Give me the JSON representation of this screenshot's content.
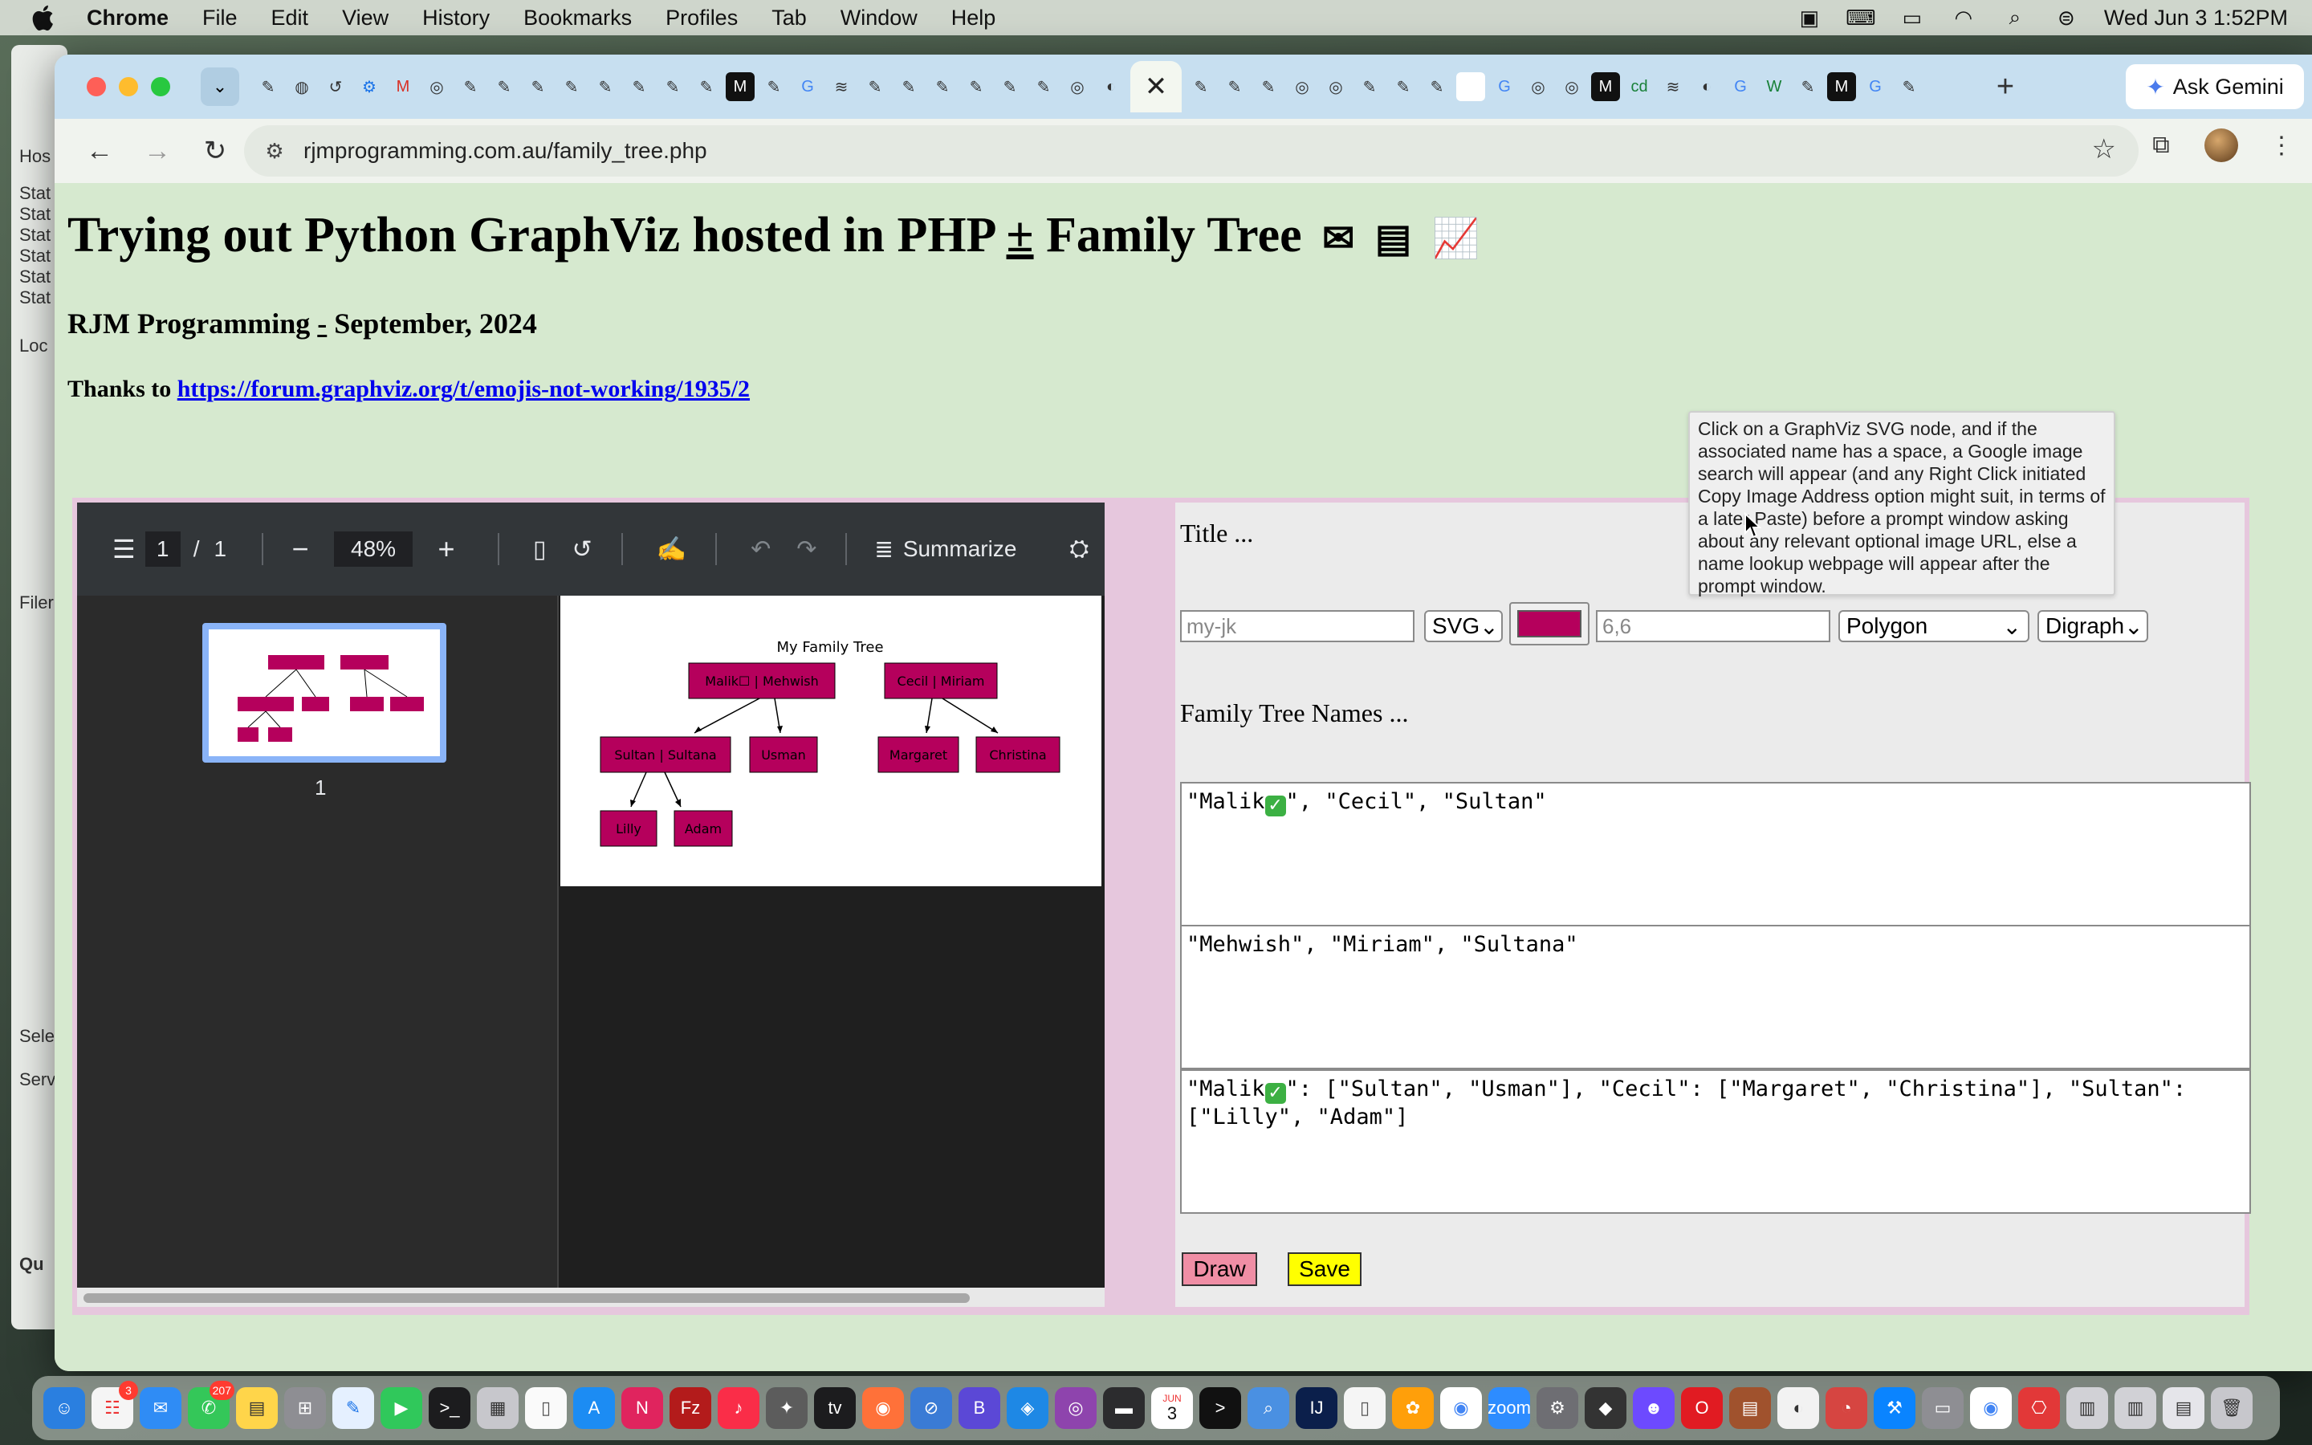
{
  "menubar": {
    "app": "Chrome",
    "items": [
      "File",
      "Edit",
      "View",
      "History",
      "Bookmarks",
      "Profiles",
      "Tab",
      "Window",
      "Help"
    ],
    "clock": "Wed Jun 3  1:52PM"
  },
  "behind_window": {
    "labels": [
      "Hos",
      "Stat",
      "Stat",
      "Stat",
      "Stat",
      "Stat",
      "Stat",
      "Loc",
      "Filer",
      "Sele",
      "Serv",
      "Qu"
    ]
  },
  "browser": {
    "ask_gemini": "Ask Gemini",
    "url": "rjmprogramming.com.au/family_tree.php"
  },
  "page": {
    "title_part1": "Trying out Python GraphViz hosted in PHP ",
    "title_pm": "±",
    "title_part2": " Family Tree",
    "subtitle_part1": "RJM Programming ",
    "subtitle_dash": "-",
    "subtitle_part2": " September, 2024",
    "thanks_label": "Thanks to ",
    "thanks_link": "https://forum.graphviz.org/t/emojis-not-working/1935/2"
  },
  "pdf_viewer": {
    "page_current": "1",
    "page_sep": "/",
    "page_total": "1",
    "zoom": "48%",
    "summarize": "Summarize",
    "thumb_label": "1"
  },
  "graph": {
    "title": "My Family Tree",
    "nodes": [
      "Malik☐ | Mehwish",
      "Cecil | Miriam",
      "Sultan | Sultana",
      "Usman",
      "Margaret",
      "Christina",
      "Lilly",
      "Adam"
    ],
    "node_color": "#b5005c"
  },
  "form": {
    "title_label": "Title ...",
    "name_placeholder": "my-jk",
    "format": "SVG",
    "color": "#b5005c",
    "size_placeholder": "6,6",
    "shape": "Polygon",
    "graph_type": "Digraph",
    "names_label": "Family Tree Names ...",
    "ta1_a": "\"Malik",
    "ta1_b": "\", \"Cecil\", \"Sultan\"",
    "ta2": "\"Mehwish\", \"Miriam\", \"Sultana\"",
    "ta3_a": "\"Malik",
    "ta3_b": "\": [\"Sultan\", \"Usman\"], \"Cecil\": [\"Margaret\", \"Christina\"], \"Sultan\":\n[\"Lilly\", \"Adam\"]",
    "draw": "Draw",
    "save": "Save"
  },
  "tooltip": "Click on a GraphViz SVG node, and if the associated name has a space, a Google image search will appear (and any Right Click initiated Copy Image Address option might suit, in terms of a later Paste) before a prompt window asking about any relevant optional image URL, else a name lookup webpage will appear after the prompt window.",
  "dock": {
    "mail_badge": "3",
    "messages_badge": "207",
    "calendar_month": "JUN",
    "calendar_day": "3"
  }
}
